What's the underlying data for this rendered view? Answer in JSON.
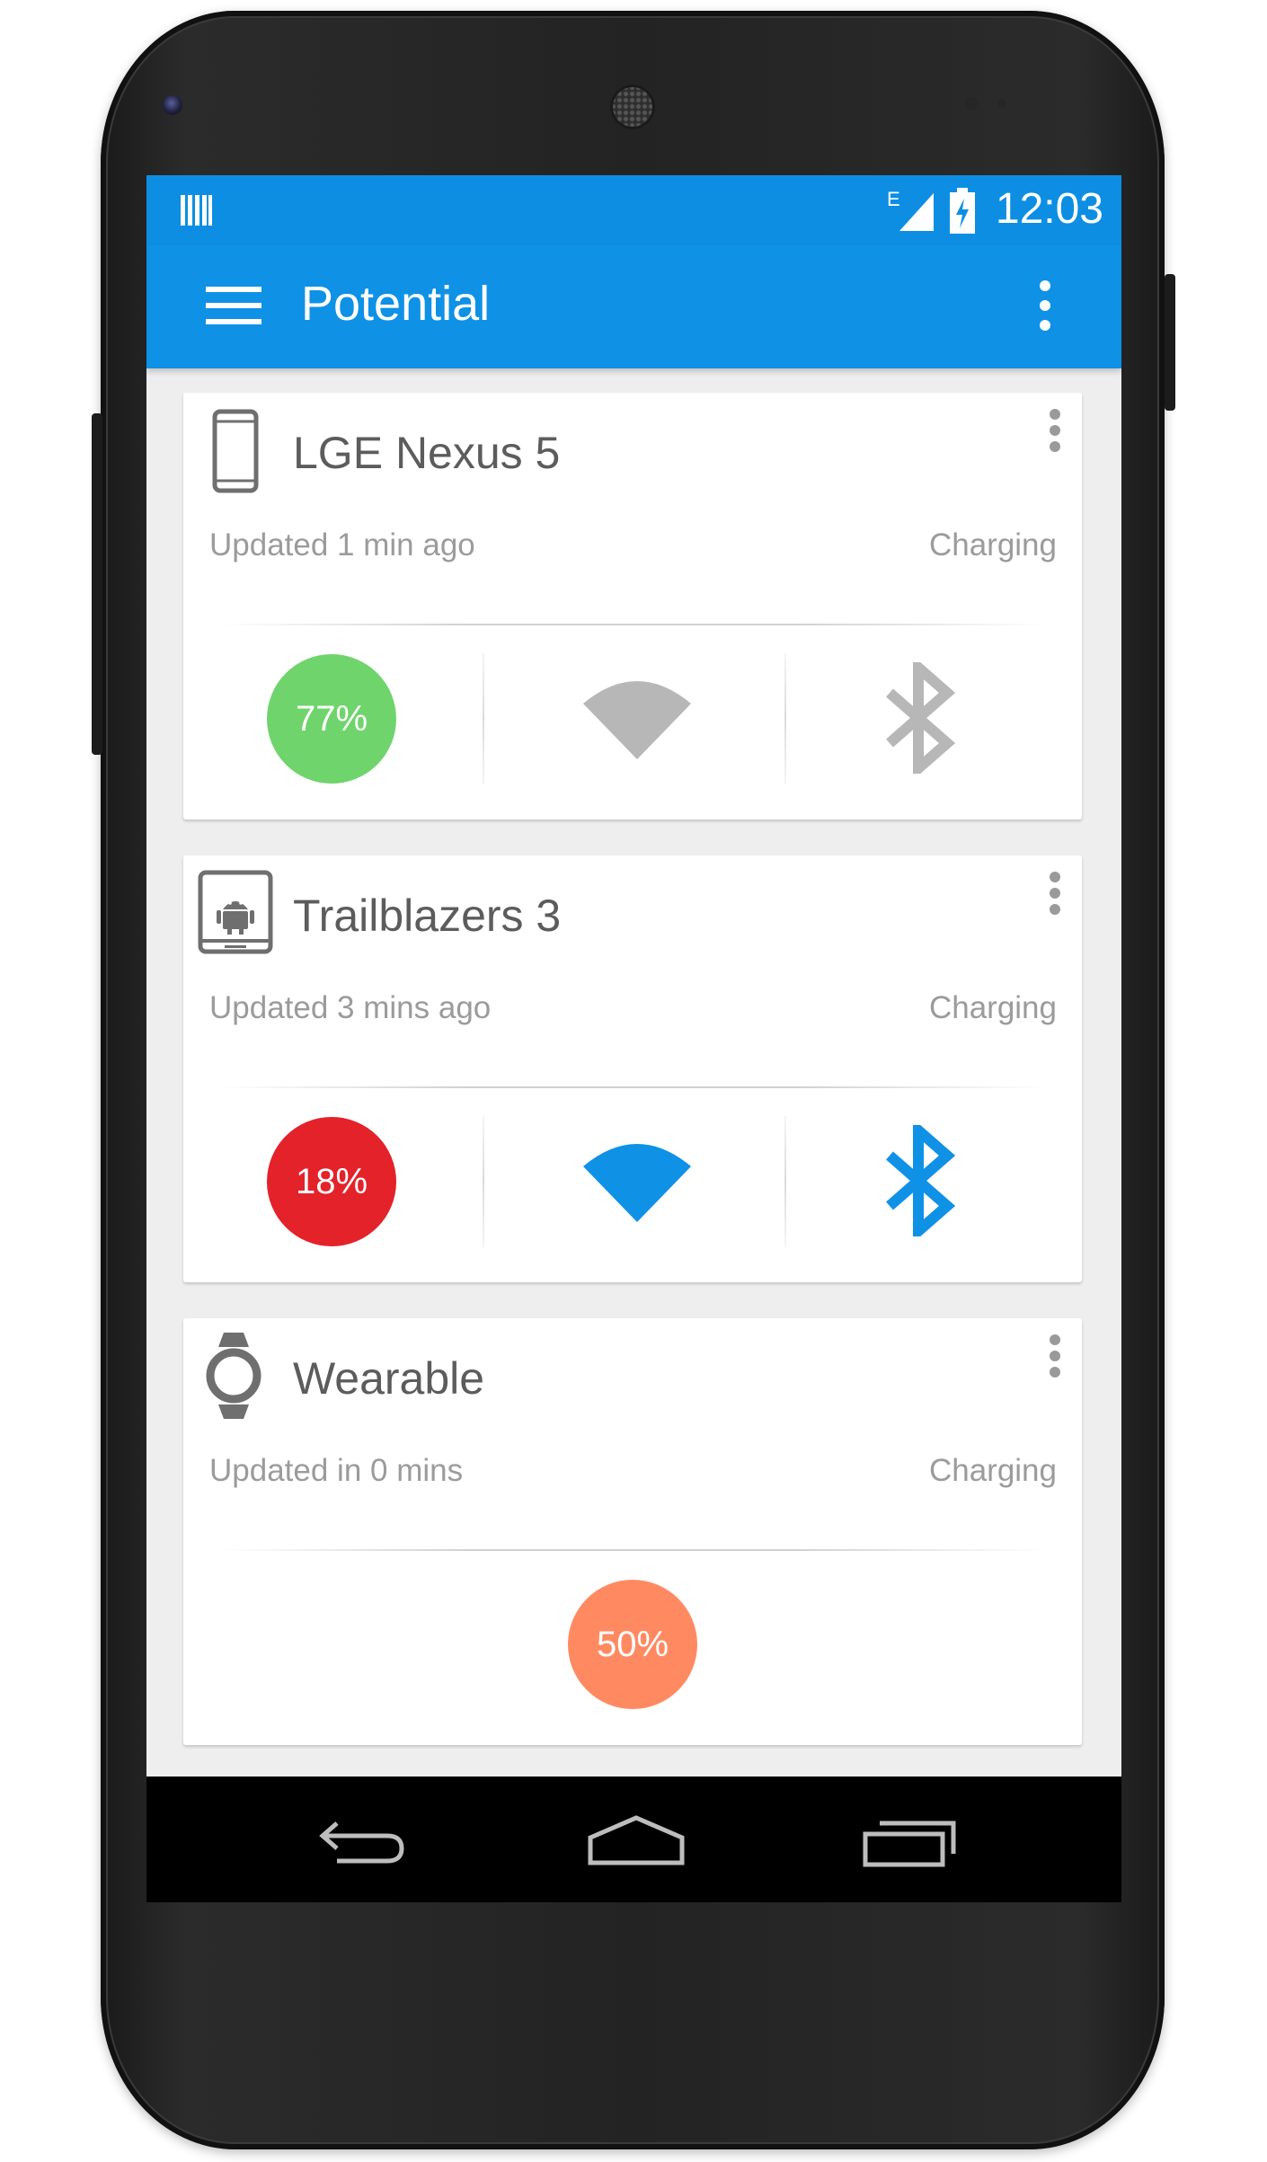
{
  "status_bar": {
    "time": "12:03",
    "network_label": "E"
  },
  "app_bar": {
    "title": "Potential"
  },
  "devices": [
    {
      "name": "LGE Nexus 5",
      "updated": "Updated 1 min ago",
      "status": "Charging",
      "battery": "77%",
      "battery_color": "#6fd46c",
      "wifi": "off",
      "bluetooth": "off"
    },
    {
      "name": "Trailblazers 3",
      "updated": "Updated 3 mins ago",
      "status": "Charging",
      "battery": "18%",
      "battery_color": "#e3222a",
      "wifi": "on",
      "bluetooth": "on"
    },
    {
      "name": "Wearable",
      "updated": "Updated in 0 mins",
      "status": "Charging",
      "battery": "50%",
      "battery_color": "#ff8a62"
    }
  ],
  "colors": {
    "primary": "#0f91e6",
    "active_icon": "#0f91e6",
    "inactive_icon": "#b7b7b7"
  },
  "icons": {
    "device_icons": [
      "phone-icon",
      "tablet-icon",
      "watch-icon"
    ],
    "nav": [
      "back-icon",
      "home-icon",
      "recents-icon"
    ]
  }
}
